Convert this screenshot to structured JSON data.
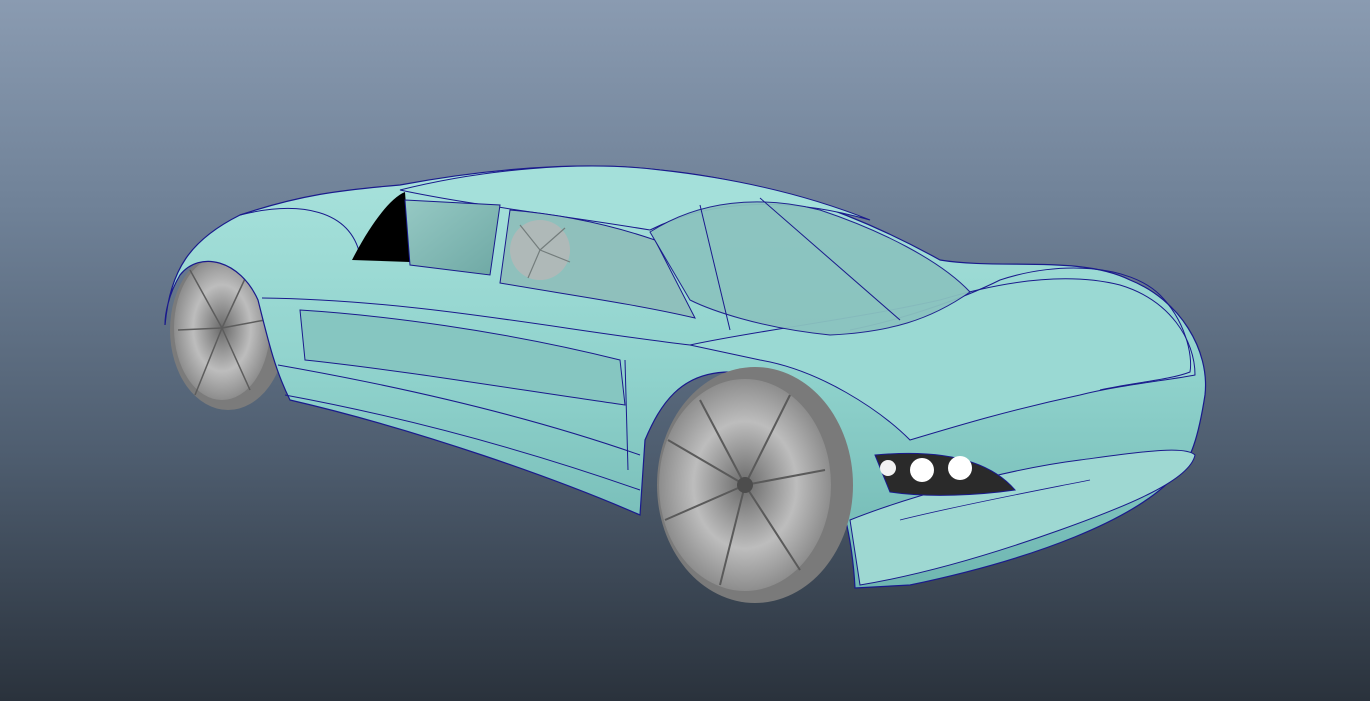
{
  "viewport": {
    "label": "",
    "background_top": "#8a9bb1",
    "background_bottom": "#2a323c"
  },
  "model": {
    "object": "sports-car",
    "body_color": "#8fd4cf",
    "wireframe_color": "#1a1a8c",
    "wheel_color": "#a9a9a9",
    "headlight_color": "#ffffff"
  }
}
